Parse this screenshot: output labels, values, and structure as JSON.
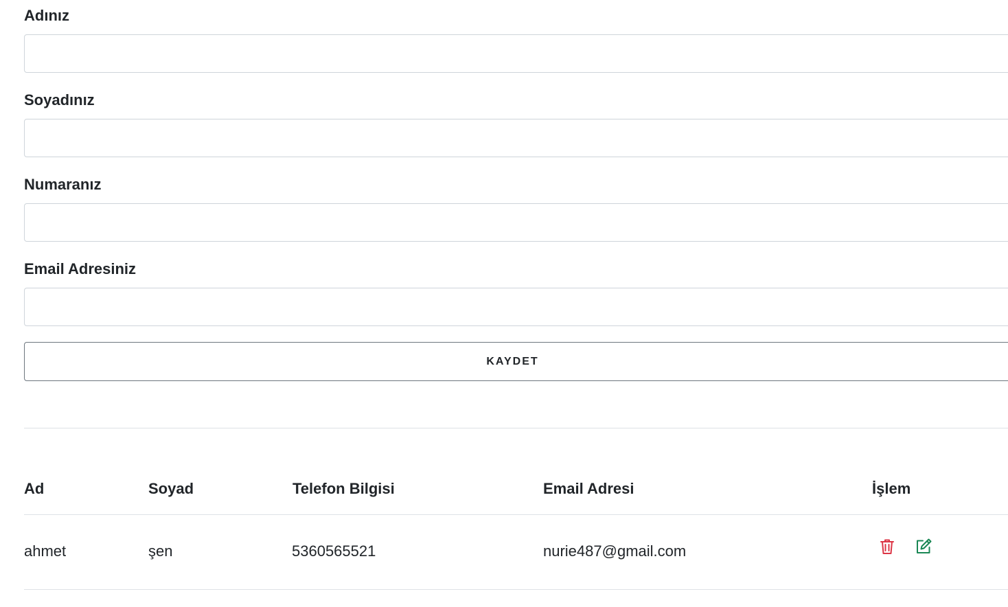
{
  "form": {
    "first_name": {
      "label": "Adınız",
      "value": "",
      "placeholder": ""
    },
    "last_name": {
      "label": "Soyadınız",
      "value": "",
      "placeholder": ""
    },
    "phone": {
      "label": "Numaranız",
      "value": "",
      "placeholder": ""
    },
    "email": {
      "label": "Email Adresiniz",
      "value": "",
      "placeholder": ""
    },
    "save_label": "KAYDET"
  },
  "table": {
    "headers": [
      "Ad",
      "Soyad",
      "Telefon Bilgisi",
      "Email Adresi",
      "İşlem"
    ],
    "rows": [
      {
        "ad": "ahmet",
        "soyad": "şen",
        "telefon": "5360565521",
        "email": "nurie487@gmail.com",
        "actions": [
          "trash-icon",
          "edit-icon"
        ]
      }
    ]
  },
  "colors": {
    "delete": "#dc3545",
    "edit": "#198754"
  }
}
